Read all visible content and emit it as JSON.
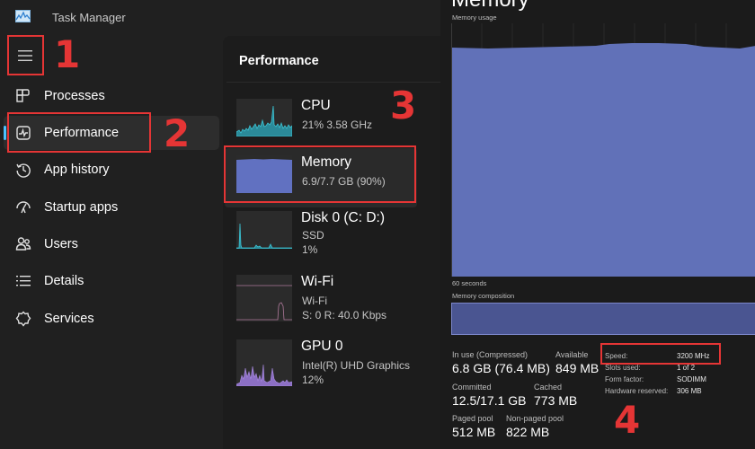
{
  "app": {
    "title": "Task Manager",
    "icon": "task-manager-icon"
  },
  "sidebar": {
    "menu_icon": "hamburger-icon",
    "items": [
      {
        "label": "Processes",
        "icon": "processes-icon",
        "active": false
      },
      {
        "label": "Performance",
        "icon": "performance-icon",
        "active": true
      },
      {
        "label": "App history",
        "icon": "history-icon",
        "active": false
      },
      {
        "label": "Startup apps",
        "icon": "startup-icon",
        "active": false
      },
      {
        "label": "Users",
        "icon": "users-icon",
        "active": false
      },
      {
        "label": "Details",
        "icon": "details-icon",
        "active": false
      },
      {
        "label": "Services",
        "icon": "services-icon",
        "active": false
      }
    ]
  },
  "performance": {
    "title": "Performance",
    "items": [
      {
        "name": "CPU",
        "line1": "21%  3.58 GHz",
        "line2": "",
        "graph_color": "#3bb3c3",
        "selected": false
      },
      {
        "name": "Memory",
        "line1": "6.9/7.7 GB (90%)",
        "line2": "",
        "graph_color": "#6171c1",
        "selected": true,
        "usage_percent": 90
      },
      {
        "name": "Disk 0 (C: D:)",
        "line1": "SSD",
        "line2": "1%",
        "graph_color": "#3bb3c3",
        "selected": false
      },
      {
        "name": "Wi-Fi",
        "line1": "Wi-Fi",
        "line2": "S: 0  R: 40.0 Kbps",
        "graph_color": "#b07a9c",
        "selected": false
      },
      {
        "name": "GPU 0",
        "line1": "Intel(R) UHD Graphics",
        "line2": "12%",
        "graph_color": "#9a78d0",
        "selected": false
      }
    ]
  },
  "memory_detail": {
    "heading": "Memory",
    "usage_label": "Memory usage",
    "time_label": "60 seconds",
    "composition_label": "Memory composition",
    "graph_color": "#6171b8",
    "stats": [
      {
        "label": "In use (Compressed)",
        "value": "6.8 GB (76.4 MB)"
      },
      {
        "label": "Available",
        "value": "849 MB"
      },
      {
        "label": "Committed",
        "value": "12.5/17.1 GB"
      },
      {
        "label": "Cached",
        "value": "773 MB"
      },
      {
        "label": "Paged pool",
        "value": "512 MB"
      },
      {
        "label": "Non-paged pool",
        "value": "822 MB"
      }
    ],
    "properties": [
      {
        "key": "Speed:",
        "value": "3200 MHz"
      },
      {
        "key": "Slots used:",
        "value": "1 of 2"
      },
      {
        "key": "Form factor:",
        "value": "SODIMM"
      },
      {
        "key": "Hardware reserved:",
        "value": "306 MB"
      }
    ]
  },
  "annotations": {
    "color": "#e53535",
    "labels": [
      "1",
      "2",
      "3",
      "4"
    ]
  }
}
